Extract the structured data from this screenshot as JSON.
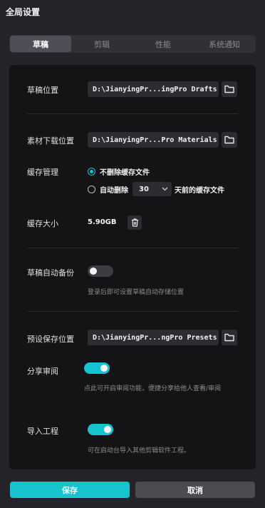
{
  "window": {
    "title": "全局设置"
  },
  "tabs": [
    {
      "label": "草稿",
      "active": true
    },
    {
      "label": "剪辑",
      "active": false
    },
    {
      "label": "性能",
      "active": false
    },
    {
      "label": "系统通知",
      "active": false
    }
  ],
  "draft_location": {
    "label": "草稿位置",
    "path": "D:\\JianyingPr...ingPro Drafts",
    "icon": "folder-icon"
  },
  "material_location": {
    "label": "素材下载位置",
    "path": "D:\\JianyingPr...Pro Materials",
    "icon": "folder-icon"
  },
  "cache_management": {
    "label": "缓存管理",
    "option_keep": "不删除缓存文件",
    "option_auto_prefix": "自动删除",
    "days_value": "30",
    "option_auto_suffix": "天前的缓存文件",
    "selected": "keep"
  },
  "cache_size": {
    "label": "缓存大小",
    "value": "5.90GB",
    "icon": "trash-icon"
  },
  "auto_backup": {
    "label": "草稿自动备份",
    "enabled": false,
    "hint": "登录后即可设置草稿自动存储位置"
  },
  "preset_location": {
    "label": "预设保存位置",
    "path": "D:\\JianyingPr...ngPro Presets",
    "icon": "folder-icon"
  },
  "share_review": {
    "label": "分享审阅",
    "enabled": true,
    "hint": "点此可开启审阅功能，便捷分享给他人查看/审阅"
  },
  "import_project": {
    "label": "导入工程",
    "enabled": true,
    "hint": "可在启动台导入其他剪辑软件工程。"
  },
  "footer": {
    "save_label": "保存",
    "cancel_label": "取消"
  },
  "colors": {
    "accent": "#17c3cf",
    "background": "#242428",
    "panel": "#141416"
  }
}
